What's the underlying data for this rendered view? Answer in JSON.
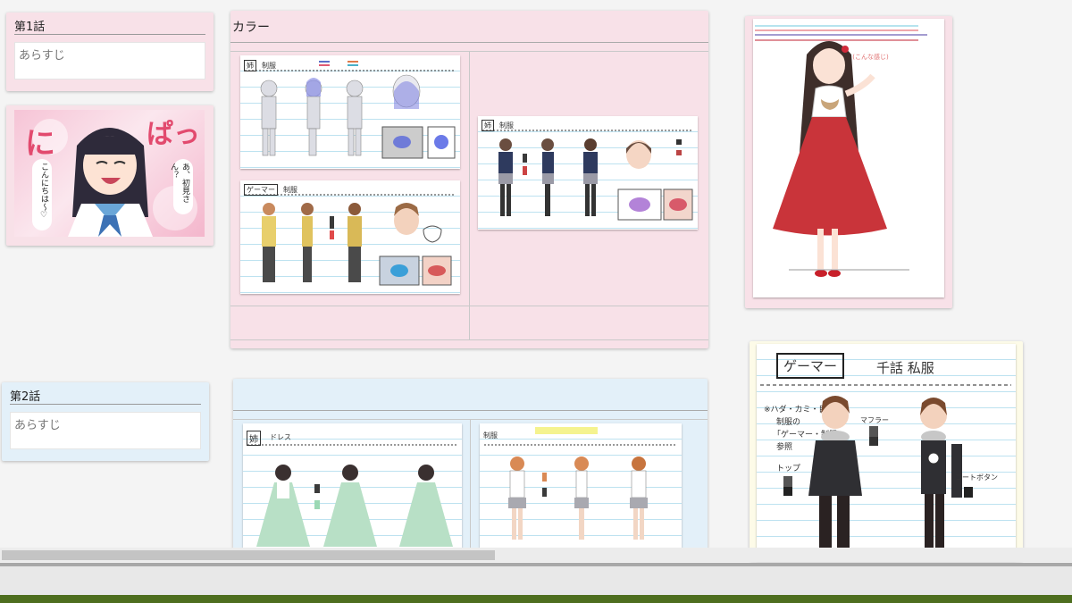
{
  "episode1": {
    "title": "第1話",
    "synopsis_placeholder": "あらすじ"
  },
  "episode2": {
    "title": "第2話",
    "synopsis_placeholder": "あらすじ"
  },
  "color_board": {
    "title": "カラー"
  },
  "colors": {
    "pink_card": "#f8e1e8",
    "blue_card": "#e3f0f9",
    "cream_card": "#fdfbe8"
  },
  "manga_panel": {
    "big_text_1": "に",
    "big_text_2": "ぱっ",
    "bubble_left": "こんにちは～♡",
    "bubble_right": "あ、初見さん？"
  },
  "sheets": {
    "sister_school": {
      "label": "姉",
      "sub": "制服"
    },
    "gamer_school": {
      "label": "ゲーマー",
      "sub": "制服"
    },
    "girl_school": {
      "label": "姉",
      "sub": "制服"
    },
    "sister_dress": {
      "label": "姉",
      "sub": "ドレス"
    },
    "gamer_private": {
      "label": "ゲーマー",
      "sub": "千話 私服"
    },
    "girl2_school": {
      "label": "制服",
      "sub": "制服"
    }
  }
}
